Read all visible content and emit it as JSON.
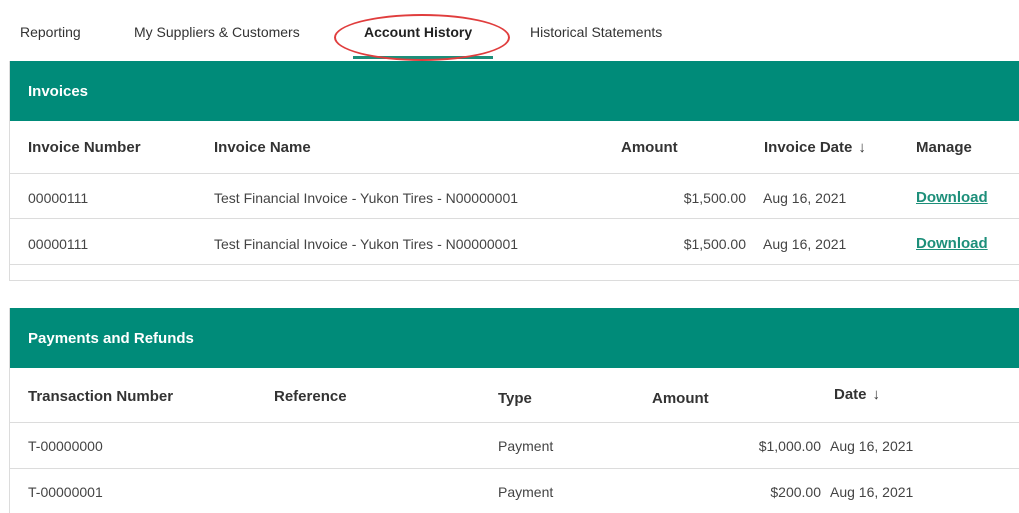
{
  "tabs": [
    {
      "label": "Reporting"
    },
    {
      "label": "My Suppliers & Customers"
    },
    {
      "label": "Account History"
    },
    {
      "label": "Historical Statements"
    }
  ],
  "invoices": {
    "title": "Invoices",
    "columns": {
      "number": "Invoice Number",
      "name": "Invoice Name",
      "amount": "Amount",
      "date": "Invoice Date",
      "manage": "Manage"
    },
    "sort_arrow": "↓",
    "rows": [
      {
        "number": "00000111",
        "name": "Test Financial Invoice - Yukon Tires - N00000001",
        "amount": "$1,500.00",
        "date": "Aug 16, 2021",
        "action": "Download"
      },
      {
        "number": "00000111",
        "name": "Test Financial Invoice - Yukon Tires - N00000001",
        "amount": "$1,500.00",
        "date": "Aug 16, 2021",
        "action": "Download"
      }
    ]
  },
  "payments": {
    "title": "Payments and Refunds",
    "columns": {
      "transaction": "Transaction Number",
      "reference": "Reference",
      "type": "Type",
      "amount": "Amount",
      "date": "Date"
    },
    "sort_arrow": "↓",
    "rows": [
      {
        "transaction": "T-00000000",
        "reference": "",
        "type": "Payment",
        "amount": "$1,000.00",
        "date": "Aug 16, 2021"
      },
      {
        "transaction": "T-00000001",
        "reference": "",
        "type": "Payment",
        "amount": "$200.00",
        "date": "Aug 16, 2021"
      }
    ]
  },
  "colors": {
    "accent": "#008b79",
    "link": "#1d8f7a",
    "highlight_circle": "#e03d3d"
  }
}
